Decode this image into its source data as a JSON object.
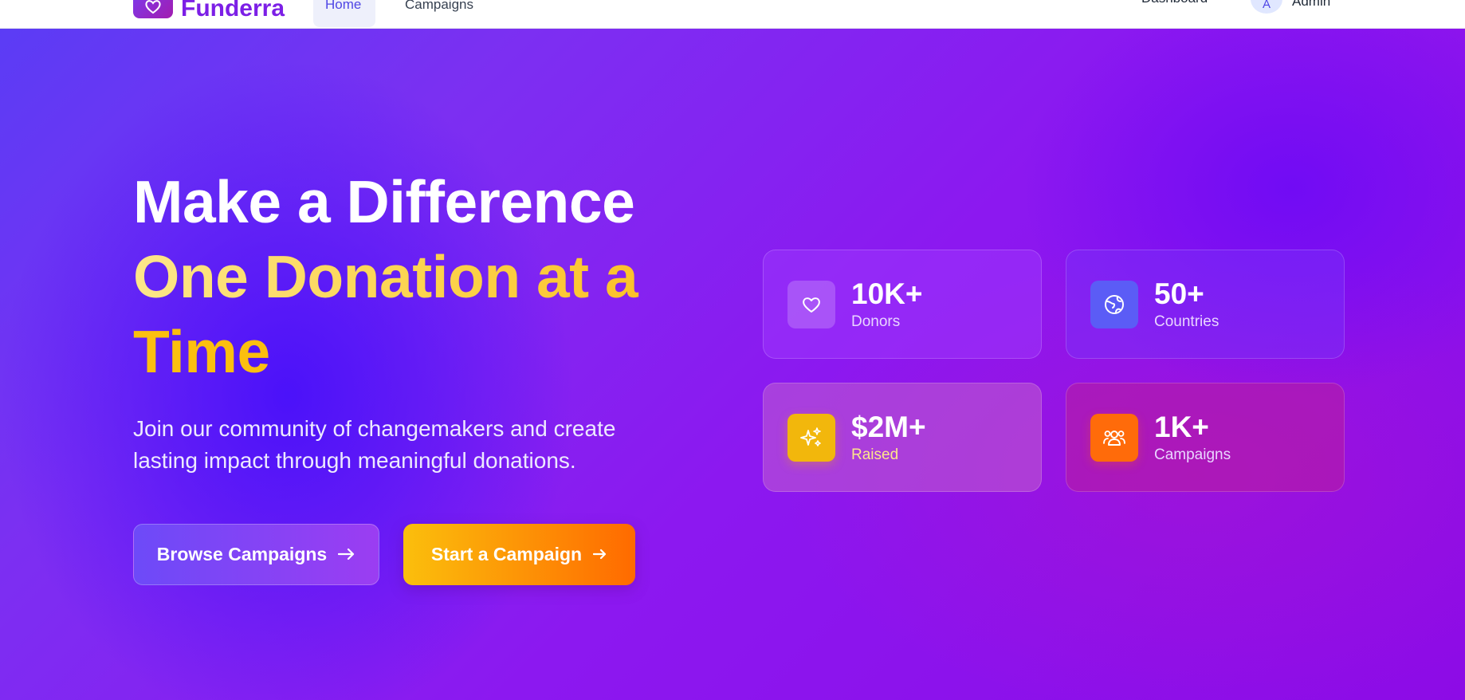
{
  "nav": {
    "brand": "Funderra",
    "tabs": [
      {
        "label": "Home",
        "active": true
      },
      {
        "label": "Campaigns",
        "active": false
      }
    ],
    "dashboard_label": "Dashboard",
    "user": {
      "initial": "A",
      "name": "Admin"
    }
  },
  "hero": {
    "headline_line1": "Make a Difference",
    "headline_line2": "One Donation at a",
    "headline_line3": "Time",
    "subtitle": "Join our community of changemakers and create lasting impact through meaningful donations.",
    "browse_button": "Browse Campaigns",
    "start_button": "Start a Campaign"
  },
  "stats": [
    {
      "value": "10K+",
      "label": "Donors",
      "icon": "heart-icon",
      "icon_color": "#ffffff33"
    },
    {
      "value": "50+",
      "label": "Countries",
      "icon": "globe-icon",
      "icon_color": "#5b5cf6"
    },
    {
      "value": "$2M+",
      "label": "Raised",
      "icon": "sparkles-icon",
      "icon_color": "#f2b70c"
    },
    {
      "value": "1K+",
      "label": "Campaigns",
      "icon": "users-icon",
      "icon_color": "#ff6b0a"
    }
  ],
  "colors": {
    "brand": "#7c1fe6",
    "accent_yellow": "#fbbf0f",
    "accent_orange": "#ff6a00",
    "hero_bg": "#8a10ef"
  }
}
